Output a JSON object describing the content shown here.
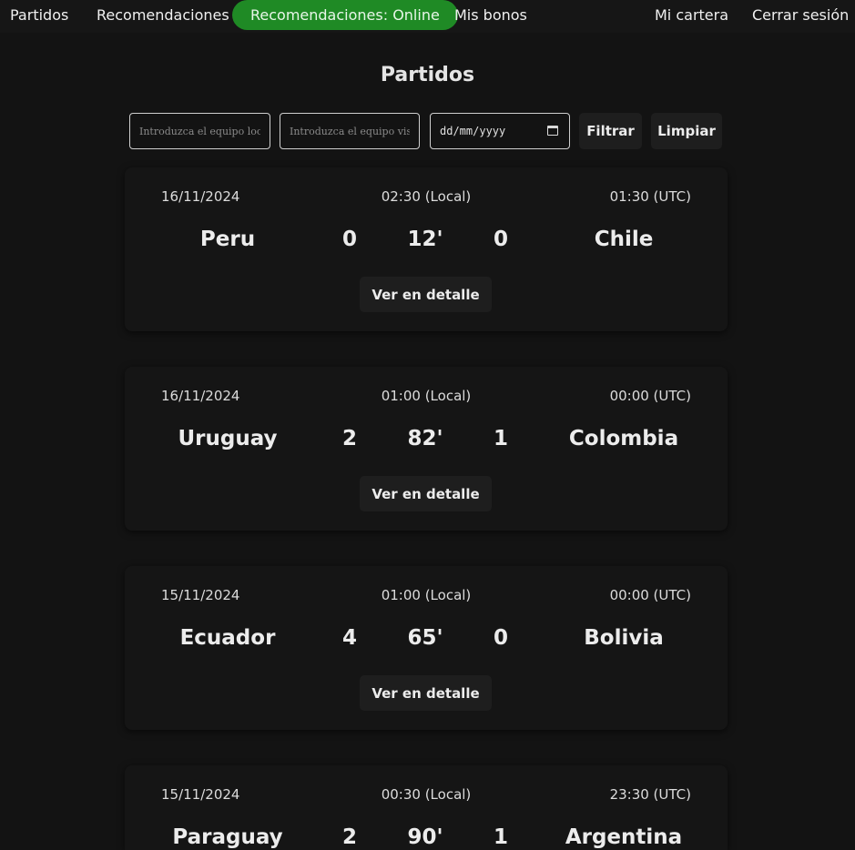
{
  "nav": {
    "partidos": "Partidos",
    "recomendaciones": "Recomendaciones",
    "recomendaciones_online": "Recomendaciones: Online",
    "mis_bonos": "Mis bonos",
    "mi_cartera": "Mi cartera",
    "cerrar_sesion": "Cerrar sesión",
    "active_color": "#1f8a25"
  },
  "page_title": "Partidos",
  "filters": {
    "home_placeholder": "Introduzca el equipo local",
    "away_placeholder": "Introduzca el equipo visitante",
    "date_placeholder": "dd/mm/yyyy",
    "date_icon": "calendar-icon",
    "filter_label": "Filtrar",
    "clear_label": "Limpiar"
  },
  "matches": [
    {
      "date": "16/11/2024",
      "local_time": "02:30 (Local)",
      "utc_time": "01:30 (UTC)",
      "home_team": "Peru",
      "home_score": "0",
      "minute": "12'",
      "away_score": "0",
      "away_team": "Chile",
      "detail_label": "Ver en detalle"
    },
    {
      "date": "16/11/2024",
      "local_time": "01:00 (Local)",
      "utc_time": "00:00 (UTC)",
      "home_team": "Uruguay",
      "home_score": "2",
      "minute": "82'",
      "away_score": "1",
      "away_team": "Colombia",
      "detail_label": "Ver en detalle"
    },
    {
      "date": "15/11/2024",
      "local_time": "01:00 (Local)",
      "utc_time": "00:00 (UTC)",
      "home_team": "Ecuador",
      "home_score": "4",
      "minute": "65'",
      "away_score": "0",
      "away_team": "Bolivia",
      "detail_label": "Ver en detalle"
    },
    {
      "date": "15/11/2024",
      "local_time": "00:30 (Local)",
      "utc_time": "23:30 (UTC)",
      "home_team": "Paraguay",
      "home_score": "2",
      "minute": "90'",
      "away_score": "1",
      "away_team": "Argentina",
      "detail_label": "Ver en detalle"
    }
  ]
}
